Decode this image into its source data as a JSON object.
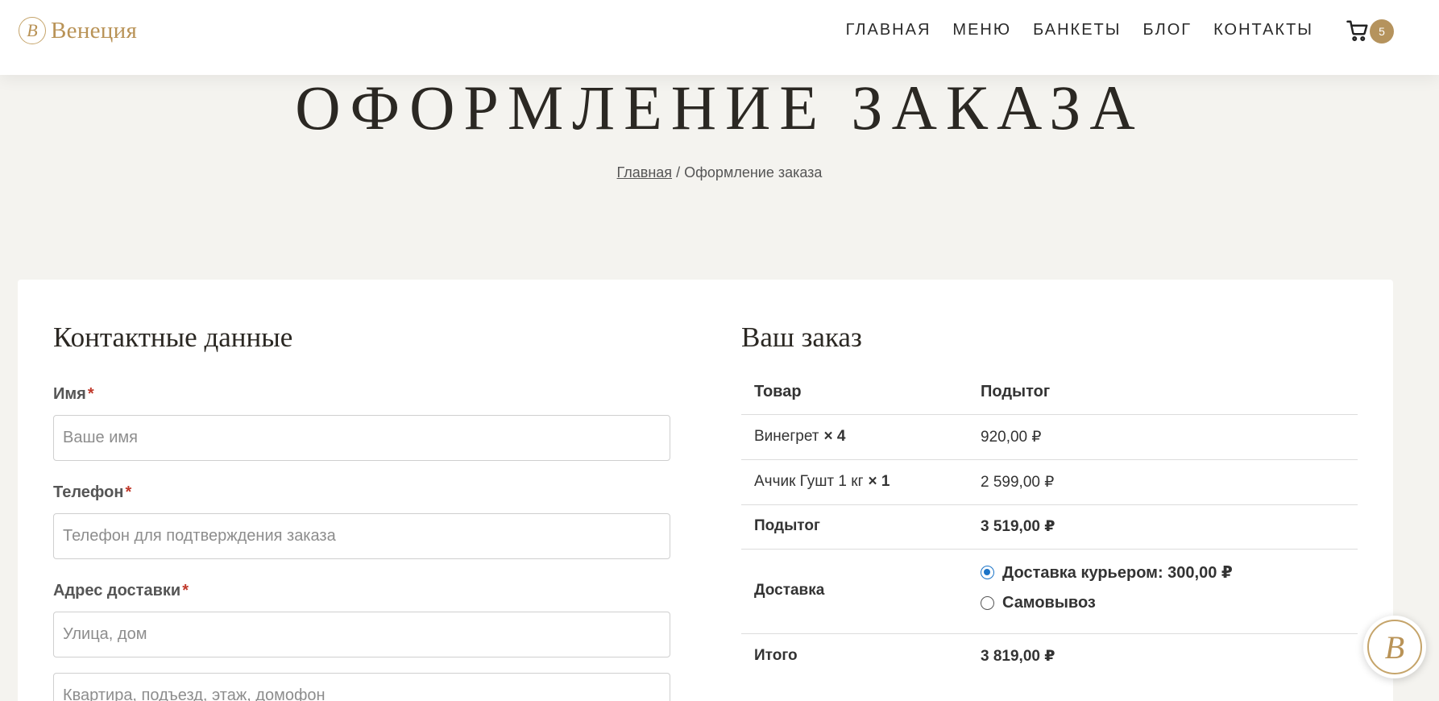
{
  "brand": {
    "logo_letter": "B",
    "name": "Венеция",
    "accent_color": "#b5935d"
  },
  "nav": {
    "items": [
      "ГЛАВНАЯ",
      "МЕНЮ",
      "БАНКЕТЫ",
      "БЛОГ",
      "КОНТАКТЫ"
    ]
  },
  "cart": {
    "icon": "cart-icon",
    "count": "5"
  },
  "hero": {
    "title": "ОФОРМЛЕНИЕ ЗАКАЗА",
    "breadcrumb": {
      "home": "Главная",
      "separator": "/",
      "current": "Оформление заказа"
    }
  },
  "contact": {
    "title": "Контактные данные",
    "required_mark": "*",
    "name_label": "Имя",
    "name_placeholder": "Ваше имя",
    "phone_label": "Телефон",
    "phone_placeholder": "Телефон для подтверждения заказа",
    "address_label": "Адрес доставки",
    "street_placeholder": "Улица, дом",
    "apt_placeholder": "Квартира, подъезд, этаж, домофон"
  },
  "order": {
    "title": "Ваш заказ",
    "col_product": "Товар",
    "col_subtotal": "Подытог",
    "items": [
      {
        "name": "Винегрет",
        "qty": "× 4",
        "price": "920,00 ₽"
      },
      {
        "name": "Аччик Гушт 1 кг",
        "qty": "× 1",
        "price": "2 599,00 ₽"
      }
    ],
    "subtotal_label": "Подытог",
    "subtotal_value": "3 519,00 ₽",
    "shipping_label": "Доставка",
    "shipping_options": [
      {
        "label": "Доставка курьером: 300,00 ₽",
        "checked": true
      },
      {
        "label": "Самовывоз",
        "checked": false
      }
    ],
    "total_label": "Итого",
    "total_value": "3 819,00 ₽"
  },
  "float_badge": {
    "letter": "B"
  }
}
